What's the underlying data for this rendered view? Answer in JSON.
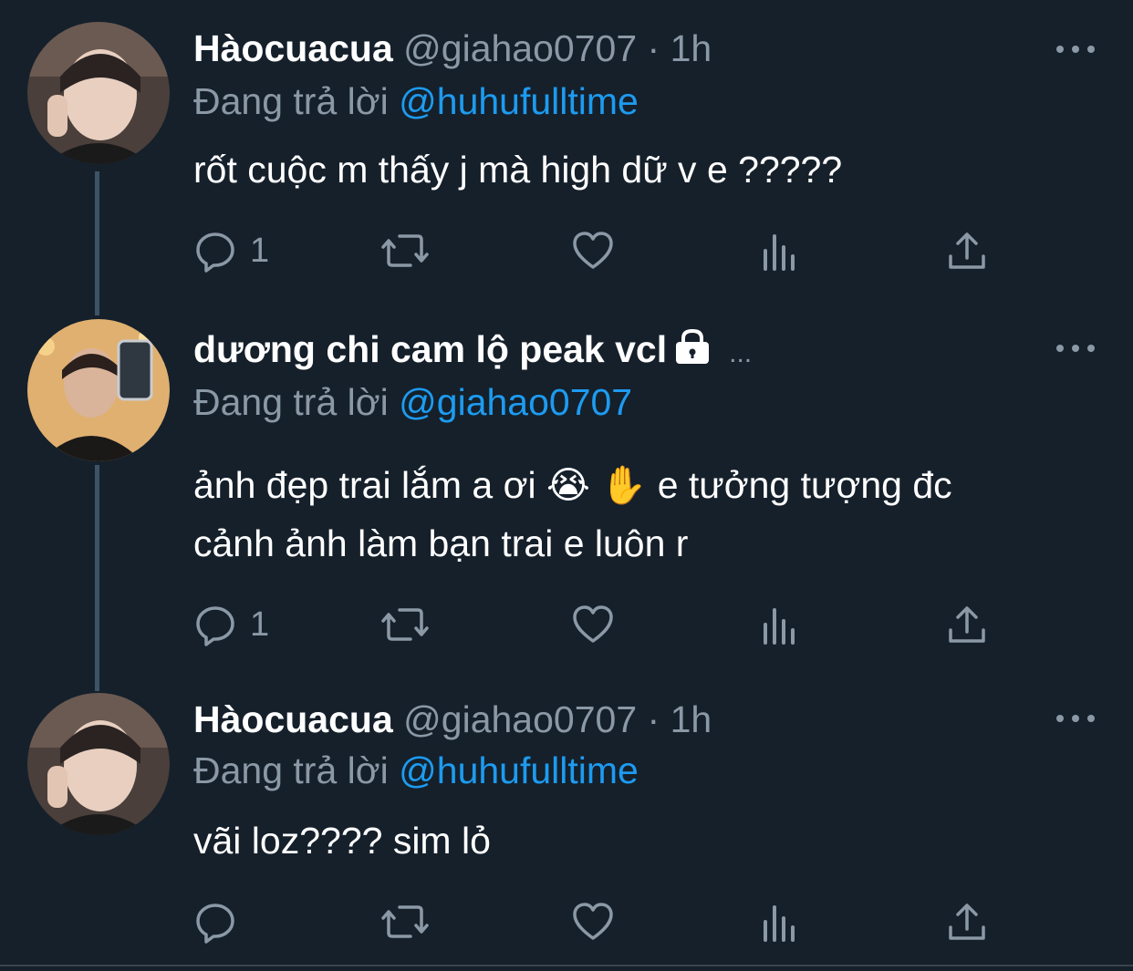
{
  "tweets": [
    {
      "name": "Hàocuacua",
      "handle": "@giahao0707",
      "dot": "·",
      "time": "1h",
      "reply_prefix": "Đang trả lời",
      "reply_mention": "@huhufulltime",
      "text": "rốt cuộc m thấy j mà high dữ v e ?????",
      "reply_count": "1"
    },
    {
      "name": "dương chi cam lộ peak vcl",
      "name_suffix": "...",
      "reply_prefix": "Đang trả lời",
      "reply_mention": "@giahao0707",
      "text_line1": "ảnh đẹp trai lắm a ơi 😭 ✋  e tưởng tượng đc",
      "text_line2": "cảnh ảnh làm bạn trai e luôn r",
      "reply_count": "1"
    },
    {
      "name": "Hàocuacua",
      "handle": "@giahao0707",
      "dot": "·",
      "time": "1h",
      "reply_prefix": "Đang trả lời",
      "reply_mention": "@huhufulltime",
      "text": "vãi loz???? sim lỏ",
      "reply_count": ""
    }
  ],
  "colors": {
    "background": "#15202b",
    "muted": "#8b98a5",
    "link": "#1d9bf0",
    "thread_line": "#3d5466"
  },
  "icons": [
    "reply-icon",
    "retweet-icon",
    "like-icon",
    "views-icon",
    "share-icon",
    "lock-icon",
    "more-icon"
  ]
}
